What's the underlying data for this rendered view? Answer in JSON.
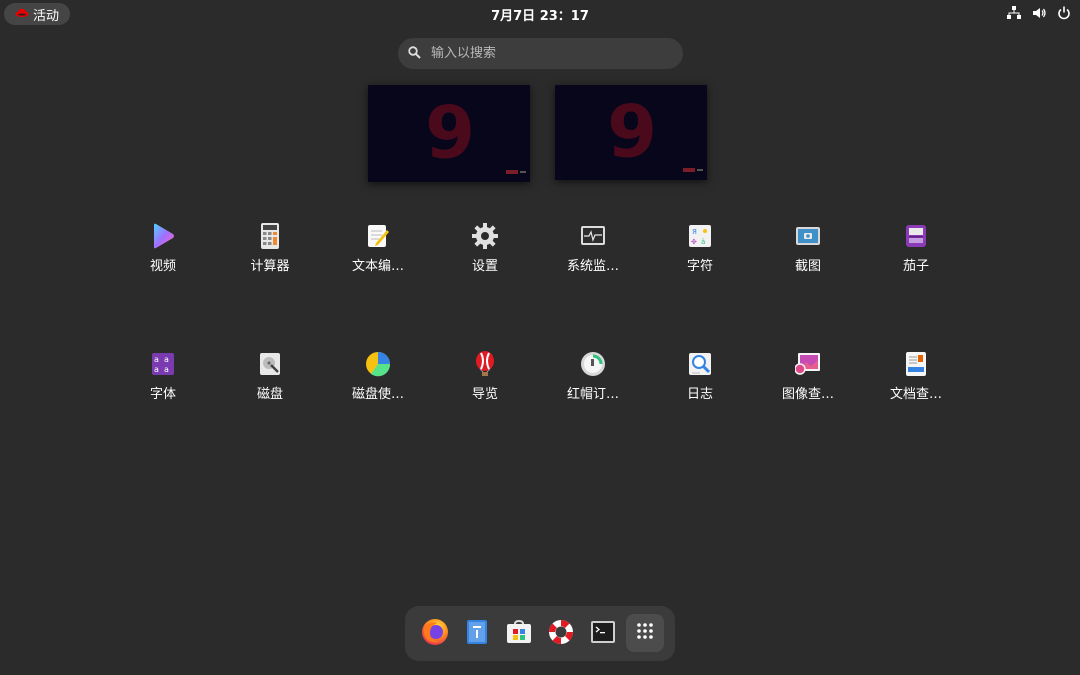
{
  "topbar": {
    "activities_label": "活动",
    "clock": "7月7日  23：17",
    "tray_icons": [
      "network-icon",
      "volume-icon",
      "power-icon"
    ]
  },
  "search": {
    "placeholder": "输入以搜索"
  },
  "workspaces": [
    {
      "wallpaper_digit": "9"
    },
    {
      "wallpaper_digit": "9"
    }
  ],
  "apps": [
    {
      "label": "视频",
      "icon": "video-icon"
    },
    {
      "label": "计算器",
      "icon": "calculator-icon"
    },
    {
      "label": "文本编…",
      "icon": "text-editor-icon"
    },
    {
      "label": "设置",
      "icon": "settings-icon"
    },
    {
      "label": "系统监…",
      "icon": "system-monitor-icon"
    },
    {
      "label": "字符",
      "icon": "characters-icon"
    },
    {
      "label": "截图",
      "icon": "screenshot-icon"
    },
    {
      "label": "茄子",
      "icon": "cheese-icon"
    },
    {
      "label": "字体",
      "icon": "fonts-icon"
    },
    {
      "label": "磁盘",
      "icon": "disks-icon"
    },
    {
      "label": "磁盘使…",
      "icon": "disk-usage-icon"
    },
    {
      "label": "导览",
      "icon": "tour-icon"
    },
    {
      "label": "红帽订…",
      "icon": "subscription-icon"
    },
    {
      "label": "日志",
      "icon": "logs-icon"
    },
    {
      "label": "图像查…",
      "icon": "image-viewer-icon"
    },
    {
      "label": "文档查…",
      "icon": "document-viewer-icon"
    }
  ],
  "dock": [
    "firefox-icon",
    "files-icon",
    "software-icon",
    "help-icon",
    "terminal-icon",
    "show-apps-icon"
  ],
  "colors": {
    "background": "#2b2b2b",
    "panel": "#454545",
    "dock": "#3b3b3b",
    "redhat": "#ee0000"
  }
}
